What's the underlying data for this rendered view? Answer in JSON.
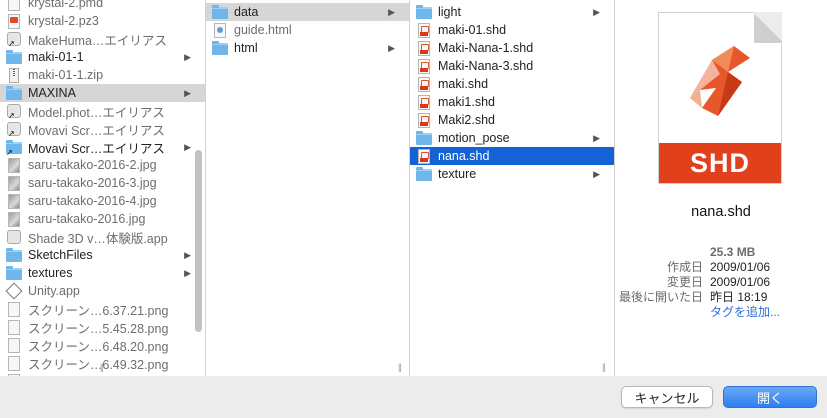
{
  "columns": {
    "col1": [
      {
        "label": "krystal-2.pmd",
        "icon": "document-icon",
        "kind": "doc",
        "dim": true
      },
      {
        "label": "krystal-2.pz3",
        "icon": "poser-document-icon",
        "kind": "red",
        "dim": true
      },
      {
        "label": "MakeHuma…エイリアス",
        "icon": "alias-app-icon",
        "kind": "app",
        "dim": true
      },
      {
        "label": "maki-01-1",
        "icon": "folder-icon",
        "kind": "folder",
        "chevron": true
      },
      {
        "label": "maki-01-1.zip",
        "icon": "zip-archive-icon",
        "kind": "zip",
        "dim": true
      },
      {
        "label": "MAXINA",
        "icon": "folder-icon",
        "kind": "folder",
        "chevron": true,
        "state": "parent"
      },
      {
        "label": "Model.phot…エイリアス",
        "icon": "alias-app-icon",
        "kind": "app",
        "dim": true
      },
      {
        "label": "Movavi Scr…エイリアス",
        "icon": "alias-app-icon",
        "kind": "app",
        "dim": true
      },
      {
        "label": "Movavi Scr…エイリアス",
        "icon": "alias-folder-icon",
        "kind": "folder",
        "chevron": true
      },
      {
        "label": "saru-takako-2016-2.jpg",
        "icon": "image-file-icon",
        "kind": "img",
        "dim": true
      },
      {
        "label": "saru-takako-2016-3.jpg",
        "icon": "image-file-icon",
        "kind": "img",
        "dim": true
      },
      {
        "label": "saru-takako-2016-4.jpg",
        "icon": "image-file-icon",
        "kind": "img",
        "dim": true
      },
      {
        "label": "saru-takako-2016.jpg",
        "icon": "image-file-icon",
        "kind": "img",
        "dim": true
      },
      {
        "label": "Shade 3D v…体験版.app",
        "icon": "shade-app-icon",
        "kind": "app",
        "dim": true
      },
      {
        "label": "SketchFiles",
        "icon": "folder-icon",
        "kind": "folder",
        "chevron": true
      },
      {
        "label": "textures",
        "icon": "folder-icon",
        "kind": "folder",
        "chevron": true
      },
      {
        "label": "Unity.app",
        "icon": "unity-app-icon",
        "kind": "unity",
        "dim": true
      },
      {
        "label": "スクリーン…6.37.21.png",
        "icon": "screenshot-file-icon",
        "kind": "doc",
        "dim": true
      },
      {
        "label": "スクリーン…5.45.28.png",
        "icon": "screenshot-file-icon",
        "kind": "doc",
        "dim": true
      },
      {
        "label": "スクリーン…6.48.20.png",
        "icon": "screenshot-file-icon",
        "kind": "doc",
        "dim": true
      },
      {
        "label": "スクリーン…6.49.32.png",
        "icon": "screenshot-file-icon",
        "kind": "doc",
        "dim": true
      },
      {
        "label": "スクリーン…",
        "icon": "screenshot-file-icon",
        "kind": "doc",
        "dim": true
      }
    ],
    "col2": [
      {
        "label": "data",
        "icon": "folder-icon",
        "kind": "folder",
        "chevron": true,
        "state": "parent"
      },
      {
        "label": "guide.html",
        "icon": "html-file-icon",
        "kind": "html",
        "dim": true
      },
      {
        "label": "html",
        "icon": "folder-icon",
        "kind": "folder",
        "chevron": true
      }
    ],
    "col3": [
      {
        "label": "light",
        "icon": "folder-icon",
        "kind": "folder",
        "chevron": true
      },
      {
        "label": "maki-01.shd",
        "icon": "shd-file-icon",
        "kind": "shd"
      },
      {
        "label": "Maki-Nana-1.shd",
        "icon": "shd-file-icon",
        "kind": "shd"
      },
      {
        "label": "Maki-Nana-3.shd",
        "icon": "shd-file-icon",
        "kind": "shd"
      },
      {
        "label": "maki.shd",
        "icon": "shd-file-icon",
        "kind": "shd"
      },
      {
        "label": "maki1.shd",
        "icon": "shd-file-icon",
        "kind": "shd"
      },
      {
        "label": "Maki2.shd",
        "icon": "shd-file-icon",
        "kind": "shd"
      },
      {
        "label": "motion_pose",
        "icon": "folder-icon",
        "kind": "folder",
        "chevron": true
      },
      {
        "label": "nana.shd",
        "icon": "shd-file-icon",
        "kind": "shd",
        "state": "sel"
      },
      {
        "label": "texture",
        "icon": "folder-icon",
        "kind": "folder",
        "chevron": true
      }
    ]
  },
  "preview": {
    "badge": "SHD",
    "filename": "nana.shd",
    "size": "25.3 MB",
    "created_label": "作成日",
    "created_value": "2009/01/06",
    "modified_label": "変更日",
    "modified_value": "2009/01/06",
    "opened_label": "最後に開いた日",
    "opened_value": "昨日 18:19",
    "add_tags": "タグを追加..."
  },
  "buttons": {
    "cancel": "キャンセル",
    "open": "開く"
  },
  "resize_glyph": "||",
  "chevron_glyph": "▶",
  "colors": {
    "selection": "#1463d6",
    "folder": "#6fb6ea",
    "shd_red": "#e0401c",
    "link": "#2a6dd6"
  }
}
